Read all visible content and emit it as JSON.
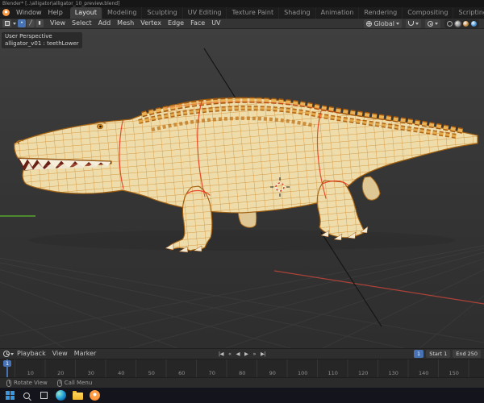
{
  "window": {
    "title": "Blender* [..\\alligator\\alligator_10_preview.blend]"
  },
  "topbar": {
    "menus": [
      "Window",
      "Help"
    ],
    "tabs": [
      {
        "label": "Layout",
        "active": true
      },
      "Modeling",
      "Sculpting",
      "UV Editing",
      "Texture Paint",
      "Shading",
      "Animation",
      "Rendering",
      "Compositing",
      "Scripting"
    ]
  },
  "viewport_header": {
    "select_modes": [
      "•",
      "╱",
      "▮"
    ],
    "menus": [
      "View",
      "Select",
      "Add",
      "Mesh",
      "Vertex",
      "Edge",
      "Face",
      "UV"
    ],
    "orientation": "Global"
  },
  "viewport": {
    "overlay_line1": "User Perspective",
    "overlay_line2": "alligator_v01 : teethLower"
  },
  "timeline": {
    "menus": [
      "Playback",
      "View",
      "Marker"
    ],
    "controls": [
      "|◀",
      "«",
      "◀",
      "▶",
      "»",
      "▶|"
    ],
    "frame": "1",
    "start_label": "Start",
    "start_value": "1",
    "end_label": "End",
    "end_value": "250",
    "playhead": "1",
    "ruler": [
      "10",
      "20",
      "30",
      "40",
      "50",
      "60",
      "70",
      "80",
      "90",
      "100",
      "110",
      "120",
      "130",
      "140",
      "150"
    ]
  },
  "statusbar": {
    "hints": [
      "Rotate View",
      "Call Menu"
    ]
  },
  "colors": {
    "accent": "#4772b3",
    "selection_orange": "#e8892b",
    "wireframe": "#d4861f",
    "seam_red": "#f0391e",
    "body_tan": "#ecd9a8",
    "axis_green": "#57a62e",
    "axis_red": "#c2453a"
  }
}
